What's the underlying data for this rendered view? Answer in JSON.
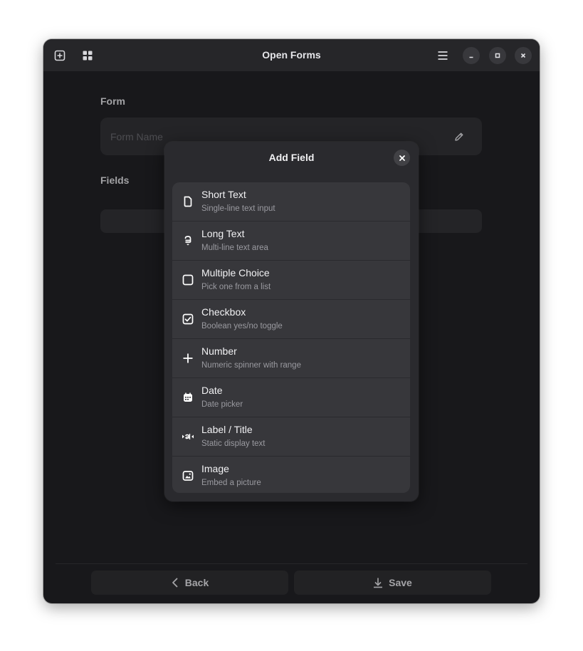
{
  "header": {
    "title": "Open Forms",
    "icons": [
      "add-form-icon",
      "grid-icon",
      "hamburger-menu-icon",
      "minimize-icon",
      "maximize-icon",
      "close-icon"
    ]
  },
  "form": {
    "section_label": "Form",
    "name_value": "",
    "name_placeholder": "Form Name",
    "fields_label": "Fields"
  },
  "footer": {
    "back_label": "Back",
    "save_label": "Save"
  },
  "dialog": {
    "title": "Add Field",
    "items": [
      {
        "title": "Short Text",
        "subtitle": "Single-line text input",
        "icon": "document-icon"
      },
      {
        "title": "Long Text",
        "subtitle": "Multi-line text area",
        "icon": "text-paragraph-icon"
      },
      {
        "title": "Multiple Choice",
        "subtitle": "Pick one from a list",
        "icon": "square-icon"
      },
      {
        "title": "Checkbox",
        "subtitle": "Boolean yes/no toggle",
        "icon": "checkbox-icon"
      },
      {
        "title": "Number",
        "subtitle": "Numeric spinner with range",
        "icon": "plus-icon"
      },
      {
        "title": "Date",
        "subtitle": "Date picker",
        "icon": "calendar-icon"
      },
      {
        "title": "Label / Title",
        "subtitle": "Static display text",
        "icon": "text-label-icon"
      },
      {
        "title": "Image",
        "subtitle": "Embed a picture",
        "icon": "image-icon"
      }
    ]
  },
  "colors": {
    "window_bg": "#1e1e21",
    "headerbar_bg": "#262629",
    "dialog_bg": "#2a2a2e",
    "list_bg": "#37373b",
    "text_primary": "#f2f2f4",
    "text_secondary": "#9a9aa0"
  }
}
